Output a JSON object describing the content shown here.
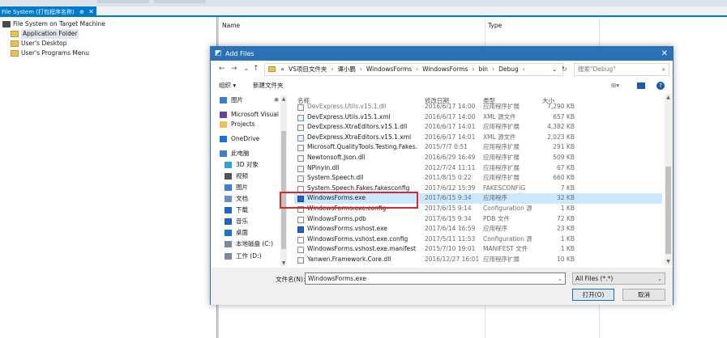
{
  "ide": {
    "tab_label": "File System (打包程序名称)",
    "tab_pin": "⊕",
    "tab_close": "✕",
    "tree": [
      {
        "label": "File System on Target Machine",
        "icon": "computer-icon",
        "level": 1
      },
      {
        "label": "Application Folder",
        "icon": "folder-icon",
        "level": 2,
        "selected": true
      },
      {
        "label": "User's Desktop",
        "icon": "folder-icon",
        "level": 2
      },
      {
        "label": "User's Programs Menu",
        "icon": "folder-icon",
        "level": 2
      }
    ],
    "columns": {
      "name": "Name",
      "type": "Type"
    }
  },
  "dialog": {
    "title": "Add Files",
    "title_icon": "visual-studio-icon",
    "close_glyph": "✕",
    "nav": {
      "back": "←",
      "forward": "→",
      "down": "⌄",
      "up": "↑"
    },
    "breadcrumb": [
      "«",
      "VS项目文件夹",
      "谭小鹏",
      "WindowsForms",
      "WindowsForms",
      "bin",
      "Debug"
    ],
    "breadcrumb_sep": "›",
    "addr_dropdown": "⌄",
    "refresh": "↻",
    "search_placeholder": "搜索\"Debug\"",
    "search_icon": "⌕",
    "organize": "组织 ▾",
    "new_folder": "新建文件夹",
    "view_toggle": "⊞▾",
    "help": "?",
    "nav_pane": [
      {
        "label": "图片",
        "icon": "pictures-icon",
        "color": "#3b7dd8",
        "pin": "✱"
      },
      {
        "label": "Microsoft Visual",
        "icon": "visual-studio-icon",
        "color": "#6a3fa0"
      },
      {
        "label": "Projects",
        "icon": "folder-icon",
        "color": "#e8c15a"
      },
      {
        "label": "OneDrive",
        "icon": "onedrive-icon",
        "color": "#1e73d1"
      },
      {
        "label": "此电脑",
        "icon": "this-pc-icon",
        "color": "#3b7dd8"
      },
      {
        "label": "3D 对象",
        "icon": "3d-objects-icon",
        "color": "#2aa3d8"
      },
      {
        "label": "视频",
        "icon": "videos-icon",
        "color": "#555555"
      },
      {
        "label": "图片",
        "icon": "pictures-icon",
        "color": "#3b7dd8"
      },
      {
        "label": "文档",
        "icon": "documents-icon",
        "color": "#6d8fc0"
      },
      {
        "label": "下载",
        "icon": "downloads-icon",
        "color": "#1f63c5"
      },
      {
        "label": "音乐",
        "icon": "music-icon",
        "color": "#1f63c5"
      },
      {
        "label": "桌面",
        "icon": "desktop-icon",
        "color": "#1e73d1"
      },
      {
        "label": "本地磁盘 (C:)",
        "icon": "drive-icon",
        "color": "#7a8a9a"
      },
      {
        "label": "工作 (D:)",
        "icon": "drive-icon",
        "color": "#7a8a9a"
      }
    ],
    "columns": {
      "name": "名称",
      "date": "修改日期",
      "type": "类型",
      "size": "大小"
    },
    "files": [
      {
        "name": "DevExpress.Utils.v15.1.dll",
        "date": "2016/6/17 14:00",
        "type": "应用程序扩展",
        "size": "7,290 KB",
        "kind": "dll",
        "clipped": true
      },
      {
        "name": "DevExpress.Utils.v15.1.xml",
        "date": "2016/6/17 14:00",
        "type": "XML 源文件",
        "size": "657 KB",
        "kind": "xml"
      },
      {
        "name": "DevExpress.XtraEditors.v15.1.dll",
        "date": "2016/6/17 14:01",
        "type": "应用程序扩展",
        "size": "4,382 KB",
        "kind": "dll"
      },
      {
        "name": "DevExpress.XtraEditors.v15.1.xml",
        "date": "2016/6/17 14:01",
        "type": "XML 源文件",
        "size": "2,023 KB",
        "kind": "xml"
      },
      {
        "name": "Microsoft.QualityTools.Testing.Fakes.",
        "date": "2015/7/7 0:51",
        "type": "应用程序扩展",
        "size": "291 KB",
        "kind": "dll"
      },
      {
        "name": "Newtonsoft.Json.dll",
        "date": "2016/6/29 16:49",
        "type": "应用程序扩展",
        "size": "509 KB",
        "kind": "dll"
      },
      {
        "name": "NPinyin.dll",
        "date": "2012/7/24 11:11",
        "type": "应用程序扩展",
        "size": "67 KB",
        "kind": "dll"
      },
      {
        "name": "System.Speech.dll",
        "date": "2011/8/15 0:22",
        "type": "应用程序扩展",
        "size": "660 KB",
        "kind": "dll"
      },
      {
        "name": "System.Speech.Fakes.fakesconfig",
        "date": "2017/6/12 15:39",
        "type": "FAKESCONFIG",
        "size": "7 KB",
        "kind": "file"
      },
      {
        "name": "WindowsForms.exe",
        "date": "2017/6/15 9:34",
        "type": "应用程序",
        "size": "32 KB",
        "kind": "exe",
        "selected": true
      },
      {
        "name": "WindowsForms.exe.config",
        "date": "2017/6/15 9:14",
        "type": "Configuration 源",
        "size": "1 KB",
        "kind": "file"
      },
      {
        "name": "WindowsForms.pdb",
        "date": "2017/6/15 9:34",
        "type": "PDB 文件",
        "size": "72 KB",
        "kind": "file"
      },
      {
        "name": "WindowsForms.vshost.exe",
        "date": "2017/6/14 16:59",
        "type": "应用程序",
        "size": "23 KB",
        "kind": "exe"
      },
      {
        "name": "WindowsForms.vshost.exe.config",
        "date": "2017/5/11 11:53",
        "type": "Configuration 源",
        "size": "1 KB",
        "kind": "file"
      },
      {
        "name": "WindowsForms.vshost.exe.manifest",
        "date": "2015/7/10 19:01",
        "type": "MANIFEST 文件",
        "size": "1 KB",
        "kind": "file"
      },
      {
        "name": "Yanwen.Framework.Core.dll",
        "date": "2016/12/27 16:01",
        "type": "应用程序扩展",
        "size": "10 KB",
        "kind": "dll"
      }
    ],
    "filename_label": "文件名(N):",
    "filename_value": "WindowsForms.exe",
    "dropdown_glyph": "⌄",
    "filter": "All Files (*.*)",
    "open_button": "打开(O)",
    "cancel_button": "取消",
    "highlight_color": "#e0252c",
    "selection_color": "#cce8ff",
    "accent_color": "#2b71b8"
  }
}
